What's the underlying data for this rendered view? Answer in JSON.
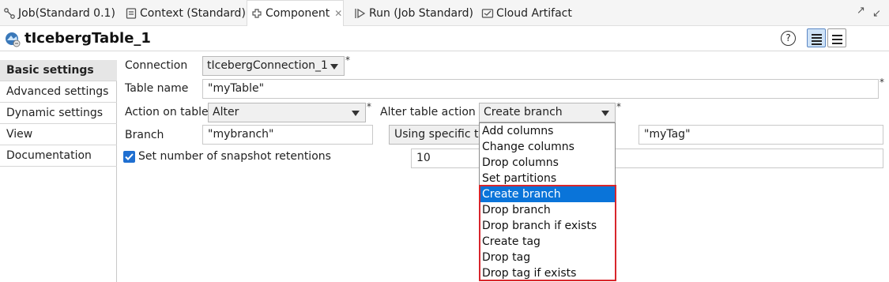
{
  "tabs": [
    {
      "label": "Job(Standard 0.1)",
      "icon": "job-icon"
    },
    {
      "label": "Context (Standard)",
      "icon": "context-icon"
    },
    {
      "label": "Component",
      "icon": "component-icon",
      "active": true,
      "close": "✕"
    },
    {
      "label": "Run (Job Standard)",
      "icon": "run-icon"
    },
    {
      "label": "Cloud Artifact",
      "icon": "cloud-artifact-icon"
    }
  ],
  "window_controls": {
    "minimize": "↗",
    "restore": "↙"
  },
  "header": {
    "title": "tIcebergTable_1",
    "help": "?"
  },
  "nav": {
    "items": [
      {
        "label": "Basic settings",
        "active": true
      },
      {
        "label": "Advanced settings"
      },
      {
        "label": "Dynamic settings"
      },
      {
        "label": "View"
      },
      {
        "label": "Documentation"
      }
    ]
  },
  "form": {
    "connection_label": "Connection",
    "connection_value": "tIcebergConnection_1",
    "table_name_label": "Table name",
    "table_name_value": "\"myTable\"",
    "action_label": "Action on table",
    "action_value": "Alter",
    "alter_action_label": "Alter table action",
    "alter_action_value": "Create branch",
    "branch_label": "Branch",
    "branch_value": "\"mybranch\"",
    "using_value": "Using specific ta",
    "tag_value": "\"myTag\"",
    "snapshot_label": "Set number of snapshot retentions",
    "snapshot_checked": true,
    "snapshot_value": "10",
    "required_mark": "*"
  },
  "dropdown": {
    "options": [
      "Add columns",
      "Change columns",
      "Drop columns",
      "Set partitions",
      "Create branch",
      "Drop branch",
      "Drop branch if exists",
      "Create tag",
      "Drop tag",
      "Drop tag if exists"
    ],
    "selected_index": 4
  },
  "colors": {
    "selection": "#0a74d9",
    "highlight_box": "#d8262c",
    "checkbox": "#1f6fd1"
  }
}
